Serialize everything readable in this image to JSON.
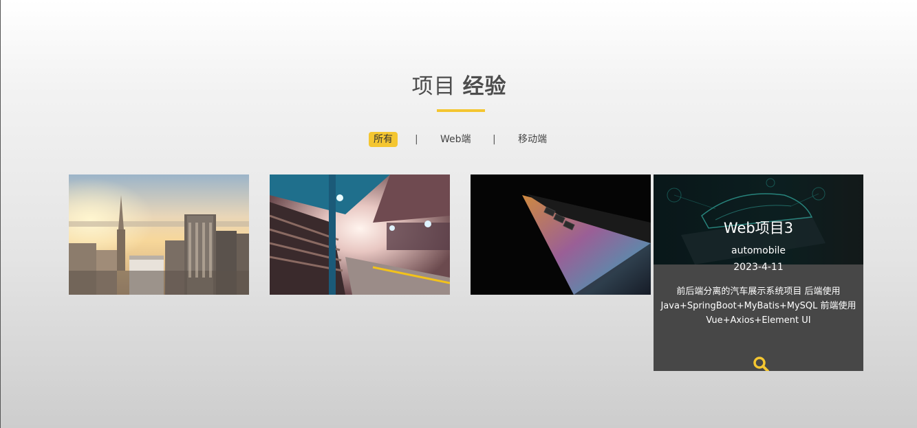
{
  "section": {
    "title_light": "项目",
    "title_bold": "经验"
  },
  "filters": {
    "all": "所有",
    "web": "Web端",
    "mobile": "移动端",
    "separator": "|"
  },
  "projects": [
    {
      "image": "city-skyline-sunset"
    },
    {
      "image": "train-station-platform"
    },
    {
      "image": "laptop-dark-gradient"
    },
    {
      "image": "automobile-wireframe-tablet",
      "title": "Web项目3",
      "category": "automobile",
      "date": "2023-4-11",
      "description_lines": [
        "前后端分离的汽车展示系统项目 后端使用",
        "Java+SpringBoot+MyBatis+MySQL 前端使用",
        "Vue+Axios+Element UI"
      ]
    }
  ],
  "colors": {
    "accent": "#f4c631",
    "overlay": "#474747"
  }
}
